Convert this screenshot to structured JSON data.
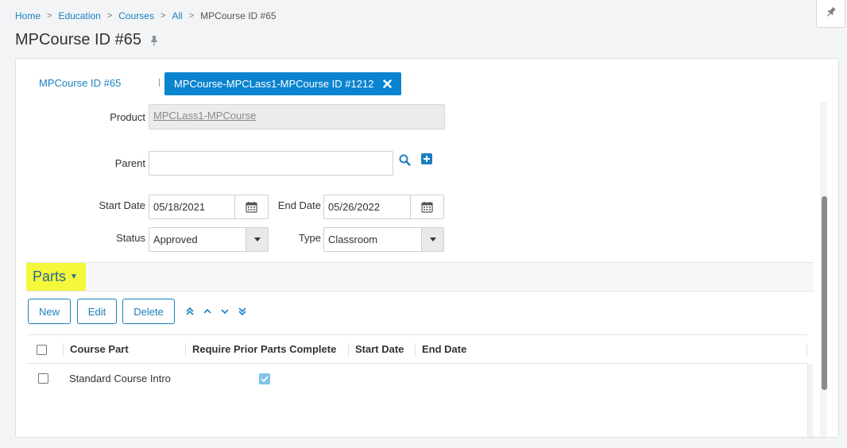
{
  "breadcrumb": {
    "items": [
      "Home",
      "Education",
      "Courses",
      "All"
    ],
    "separator": ">",
    "current": "MPCourse ID #65"
  },
  "page": {
    "title": "MPCourse ID #65"
  },
  "tabs": {
    "link_label": "MPCourse ID #65",
    "active_label": "MPCourse-MPCLass1-MPCourse ID #1212"
  },
  "form": {
    "product_label": "Product",
    "product_value": "MPCLass1-MPCourse",
    "parent_label": "Parent",
    "parent_value": "",
    "start_date_label": "Start Date",
    "start_date_value": "05/18/2021",
    "end_date_label": "End Date",
    "end_date_value": "05/26/2022",
    "status_label": "Status",
    "status_value": "Approved",
    "type_label": "Type",
    "type_value": "Classroom"
  },
  "parts": {
    "title": "Parts",
    "buttons": {
      "new": "New",
      "edit": "Edit",
      "delete": "Delete"
    },
    "columns": [
      "Course Part",
      "Require Prior Parts Complete",
      "Start Date",
      "End Date"
    ],
    "rows": [
      {
        "course_part": "Standard Course Intro",
        "require_prior_complete": true,
        "start_date": "",
        "end_date": ""
      }
    ]
  },
  "colors": {
    "accent": "#0b84d0",
    "link": "#1a7fc1",
    "highlight": "#f4f73a"
  },
  "icons": [
    "pin-icon",
    "close-icon",
    "search-icon",
    "add-icon",
    "calendar-icon",
    "caret-down-icon",
    "move-top-icon",
    "move-up-icon",
    "move-down-icon",
    "move-bottom-icon",
    "check-icon"
  ]
}
